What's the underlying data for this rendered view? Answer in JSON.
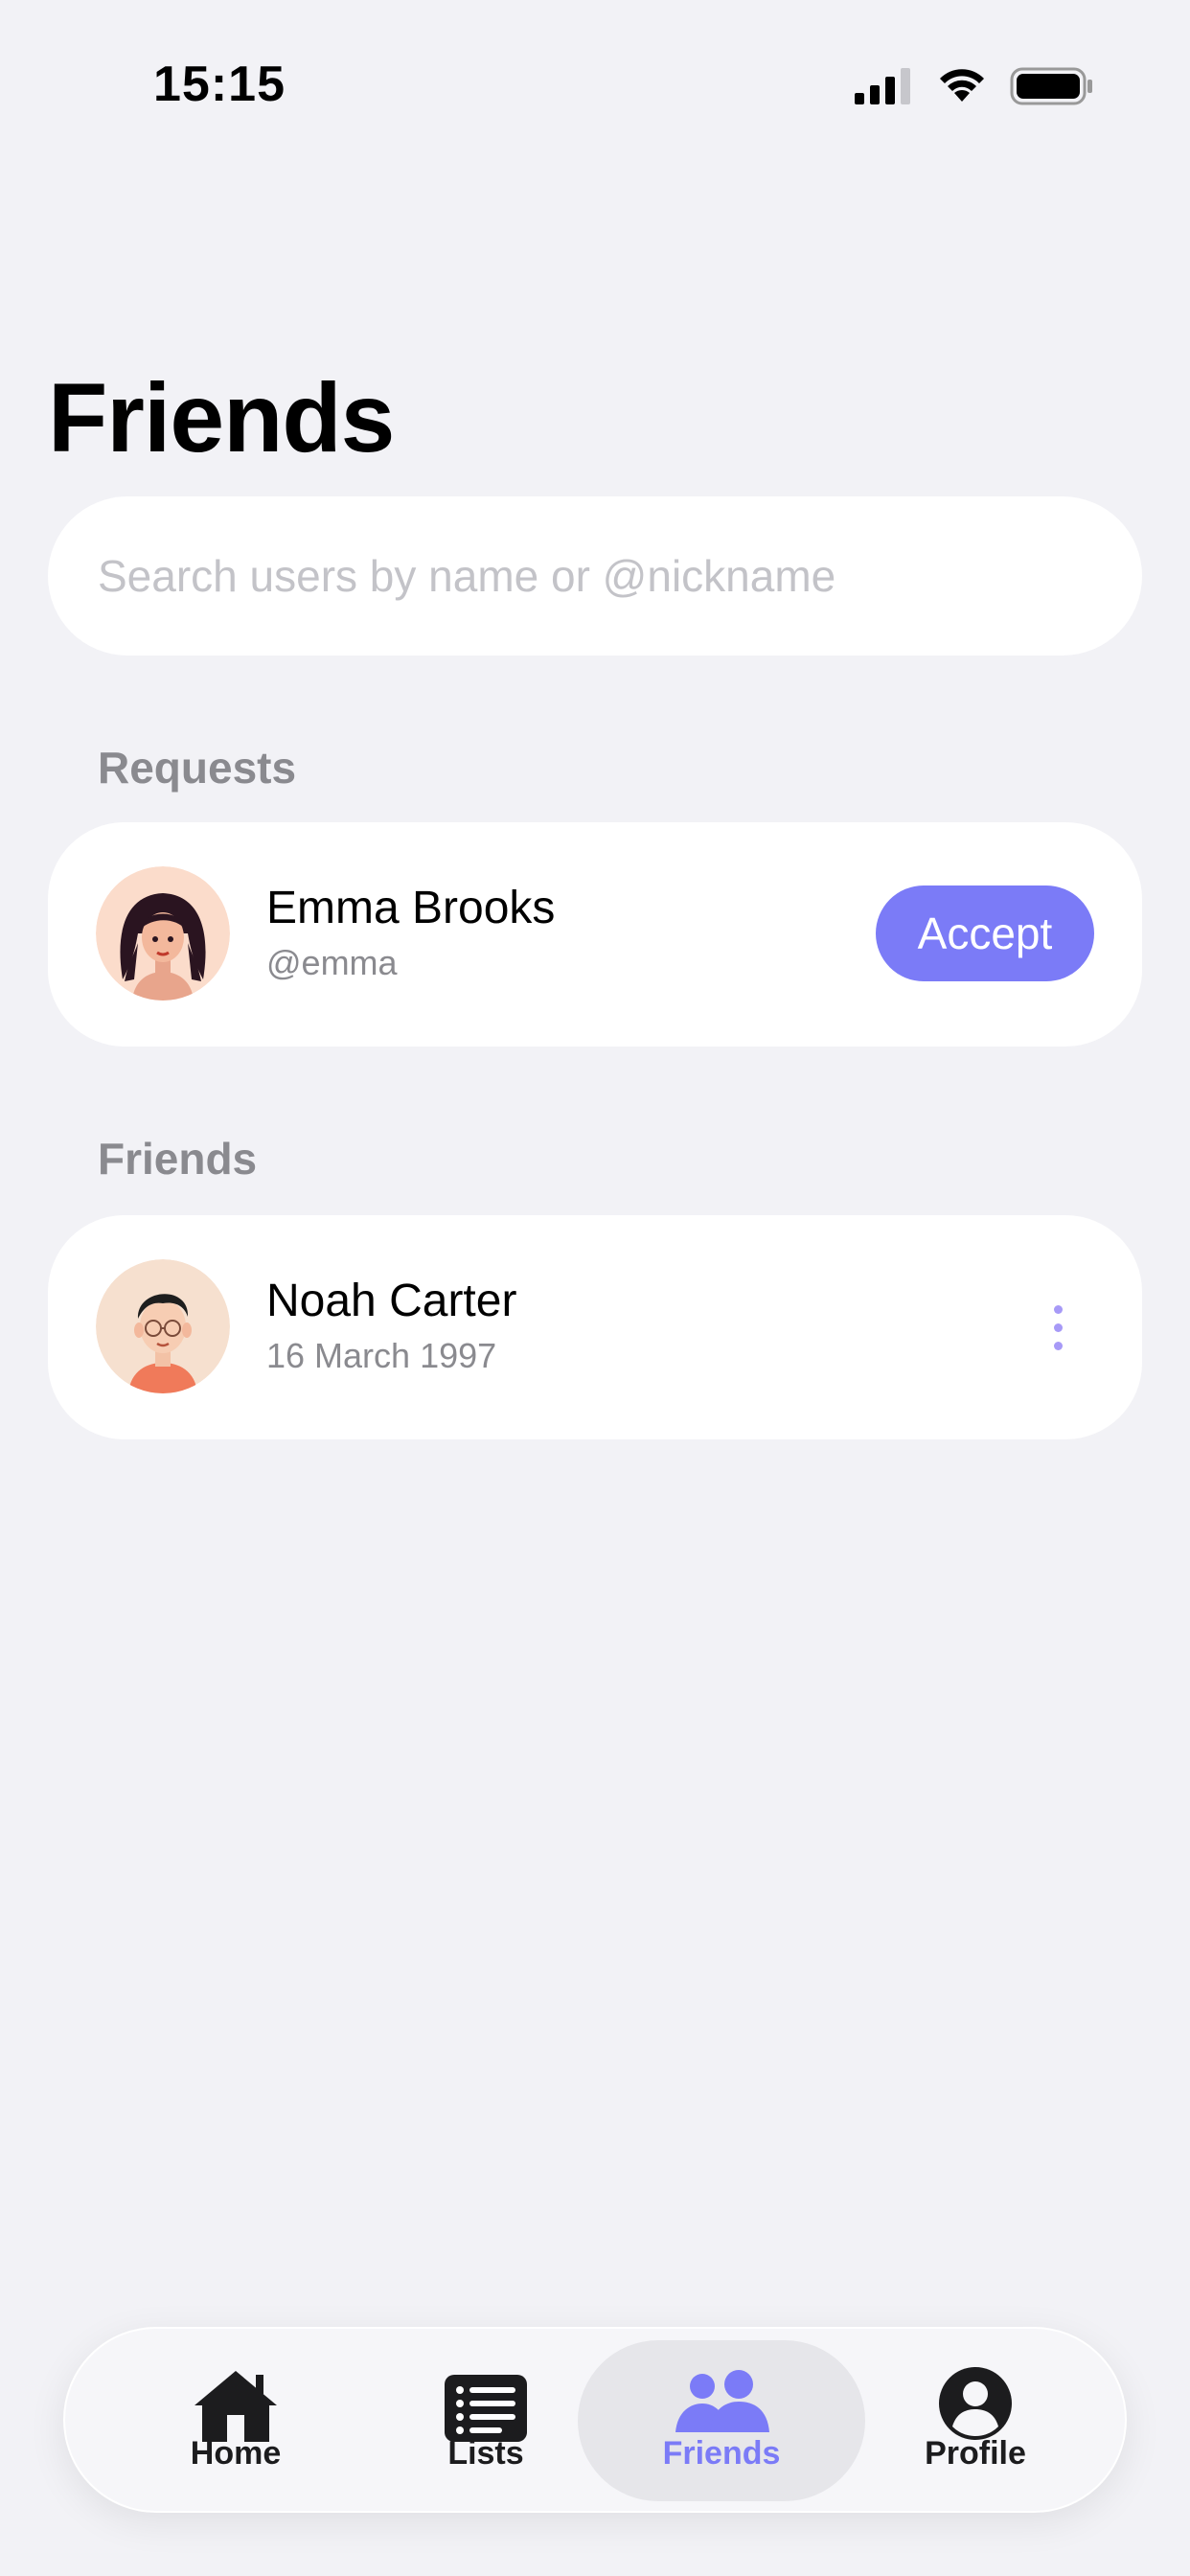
{
  "status_bar": {
    "time": "15:15"
  },
  "page": {
    "title": "Friends"
  },
  "search": {
    "placeholder": "Search users by name or @nickname",
    "value": ""
  },
  "requests": {
    "section_label": "Requests",
    "items": [
      {
        "name": "Emma Brooks",
        "handle": "@emma",
        "action_label": "Accept"
      }
    ]
  },
  "friends": {
    "section_label": "Friends",
    "items": [
      {
        "name": "Noah Carter",
        "birthday": "16 March 1997"
      }
    ]
  },
  "tab_bar": {
    "items": [
      {
        "label": "Home",
        "icon": "house-icon"
      },
      {
        "label": "Lists",
        "icon": "list-icon"
      },
      {
        "label": "Friends",
        "icon": "people-icon",
        "active": true
      },
      {
        "label": "Profile",
        "icon": "person-circle-icon"
      }
    ]
  },
  "colors": {
    "accent": "#7b7bf7",
    "background": "#f2f2f6",
    "card": "#ffffff",
    "secondary_text": "#8a8a8f"
  }
}
